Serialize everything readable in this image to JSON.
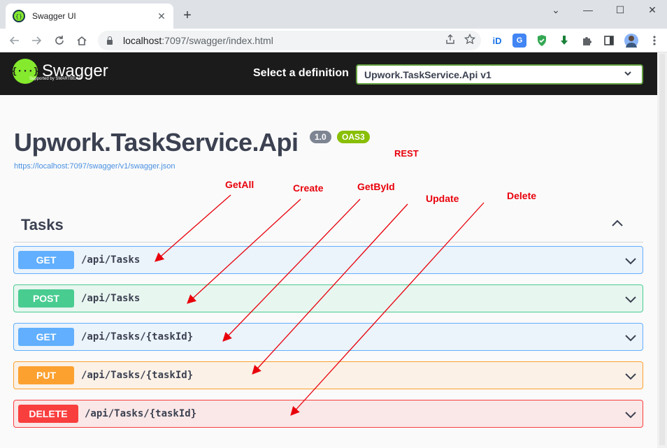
{
  "browser": {
    "tab_title": "Swagger UI",
    "tab_close": "✕",
    "new_tab": "+",
    "window": {
      "minimize": "⌄",
      "restore": "—",
      "maximize": "☐",
      "close": "✕"
    },
    "url_host": "localhost",
    "url_path": ":7097/swagger/index.html",
    "extensions": [
      "iD-icon",
      "translate-icon",
      "shield-icon",
      "download-icon",
      "puzzle-icon",
      "sidepanel-icon",
      "profile-avatar",
      "menu-icon"
    ]
  },
  "swagger": {
    "logo_text": "Swagger",
    "logo_icon": "{···}",
    "logo_sub": "Supported by SMARTBEAR",
    "definition_label": "Select a definition",
    "definition_value": "Upwork.TaskService.Api v1",
    "api_title": "Upwork.TaskService.Api",
    "version_badge": "1.0",
    "oas_badge": "OAS3",
    "spec_link": "https://localhost:7097/swagger/v1/swagger.json",
    "tag_name": "Tasks",
    "operations": [
      {
        "method": "GET",
        "path": "/api/Tasks"
      },
      {
        "method": "POST",
        "path": "/api/Tasks"
      },
      {
        "method": "GET",
        "path": "/api/Tasks/{taskId}"
      },
      {
        "method": "PUT",
        "path": "/api/Tasks/{taskId}"
      },
      {
        "method": "DELETE",
        "path": "/api/Tasks/{taskId}"
      }
    ]
  },
  "annotations": {
    "rest": "REST",
    "get_all": "GetAll",
    "create": "Create",
    "get_by_id": "GetById",
    "update": "Update",
    "delete": "Delete"
  },
  "colors": {
    "get": "#61affe",
    "post": "#49cc90",
    "put": "#fca130",
    "delete": "#f93e3e",
    "annotation": "#e8000b",
    "topbar": "#1b1b1b",
    "logo_green": "#85ea2d"
  }
}
